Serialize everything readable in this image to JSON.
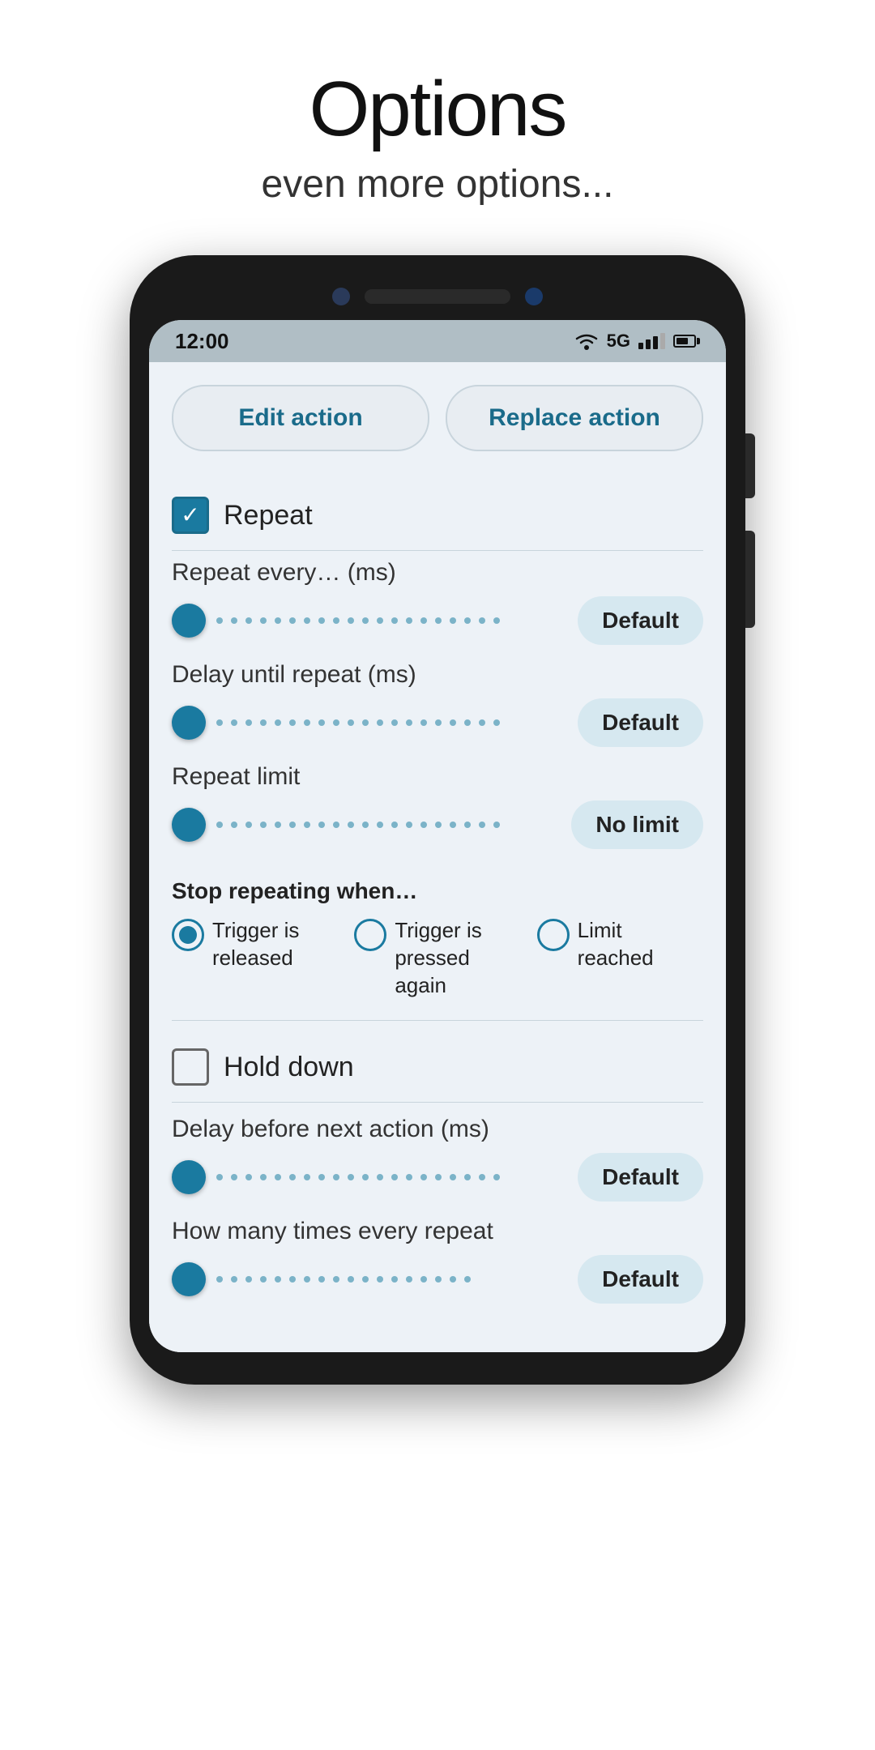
{
  "header": {
    "title": "Options",
    "subtitle": "even more options..."
  },
  "statusBar": {
    "time": "12:00",
    "network": "5G"
  },
  "tabs": [
    {
      "id": "edit",
      "label": "Edit action"
    },
    {
      "id": "replace",
      "label": "Replace action"
    }
  ],
  "options": {
    "repeat": {
      "label": "Repeat",
      "checked": true
    },
    "repeatEvery": {
      "label": "Repeat every… (ms)",
      "value": "Default"
    },
    "delayUntilRepeat": {
      "label": "Delay until repeat (ms)",
      "value": "Default"
    },
    "repeatLimit": {
      "label": "Repeat limit",
      "value": "No limit"
    },
    "stopRepeatingWhen": {
      "label": "Stop repeating when…",
      "options": [
        {
          "id": "trigger-released",
          "label": "Trigger is released",
          "selected": true
        },
        {
          "id": "trigger-pressed-again",
          "label": "Trigger is pressed again",
          "selected": false
        },
        {
          "id": "limit-reached",
          "label": "Limit reached",
          "selected": false
        }
      ]
    },
    "holdDown": {
      "label": "Hold down",
      "checked": false
    },
    "delayBeforeNextAction": {
      "label": "Delay before next action (ms)",
      "value": "Default"
    },
    "howManyTimesEveryRepeat": {
      "label": "How many times every repeat",
      "value": "Default"
    }
  }
}
